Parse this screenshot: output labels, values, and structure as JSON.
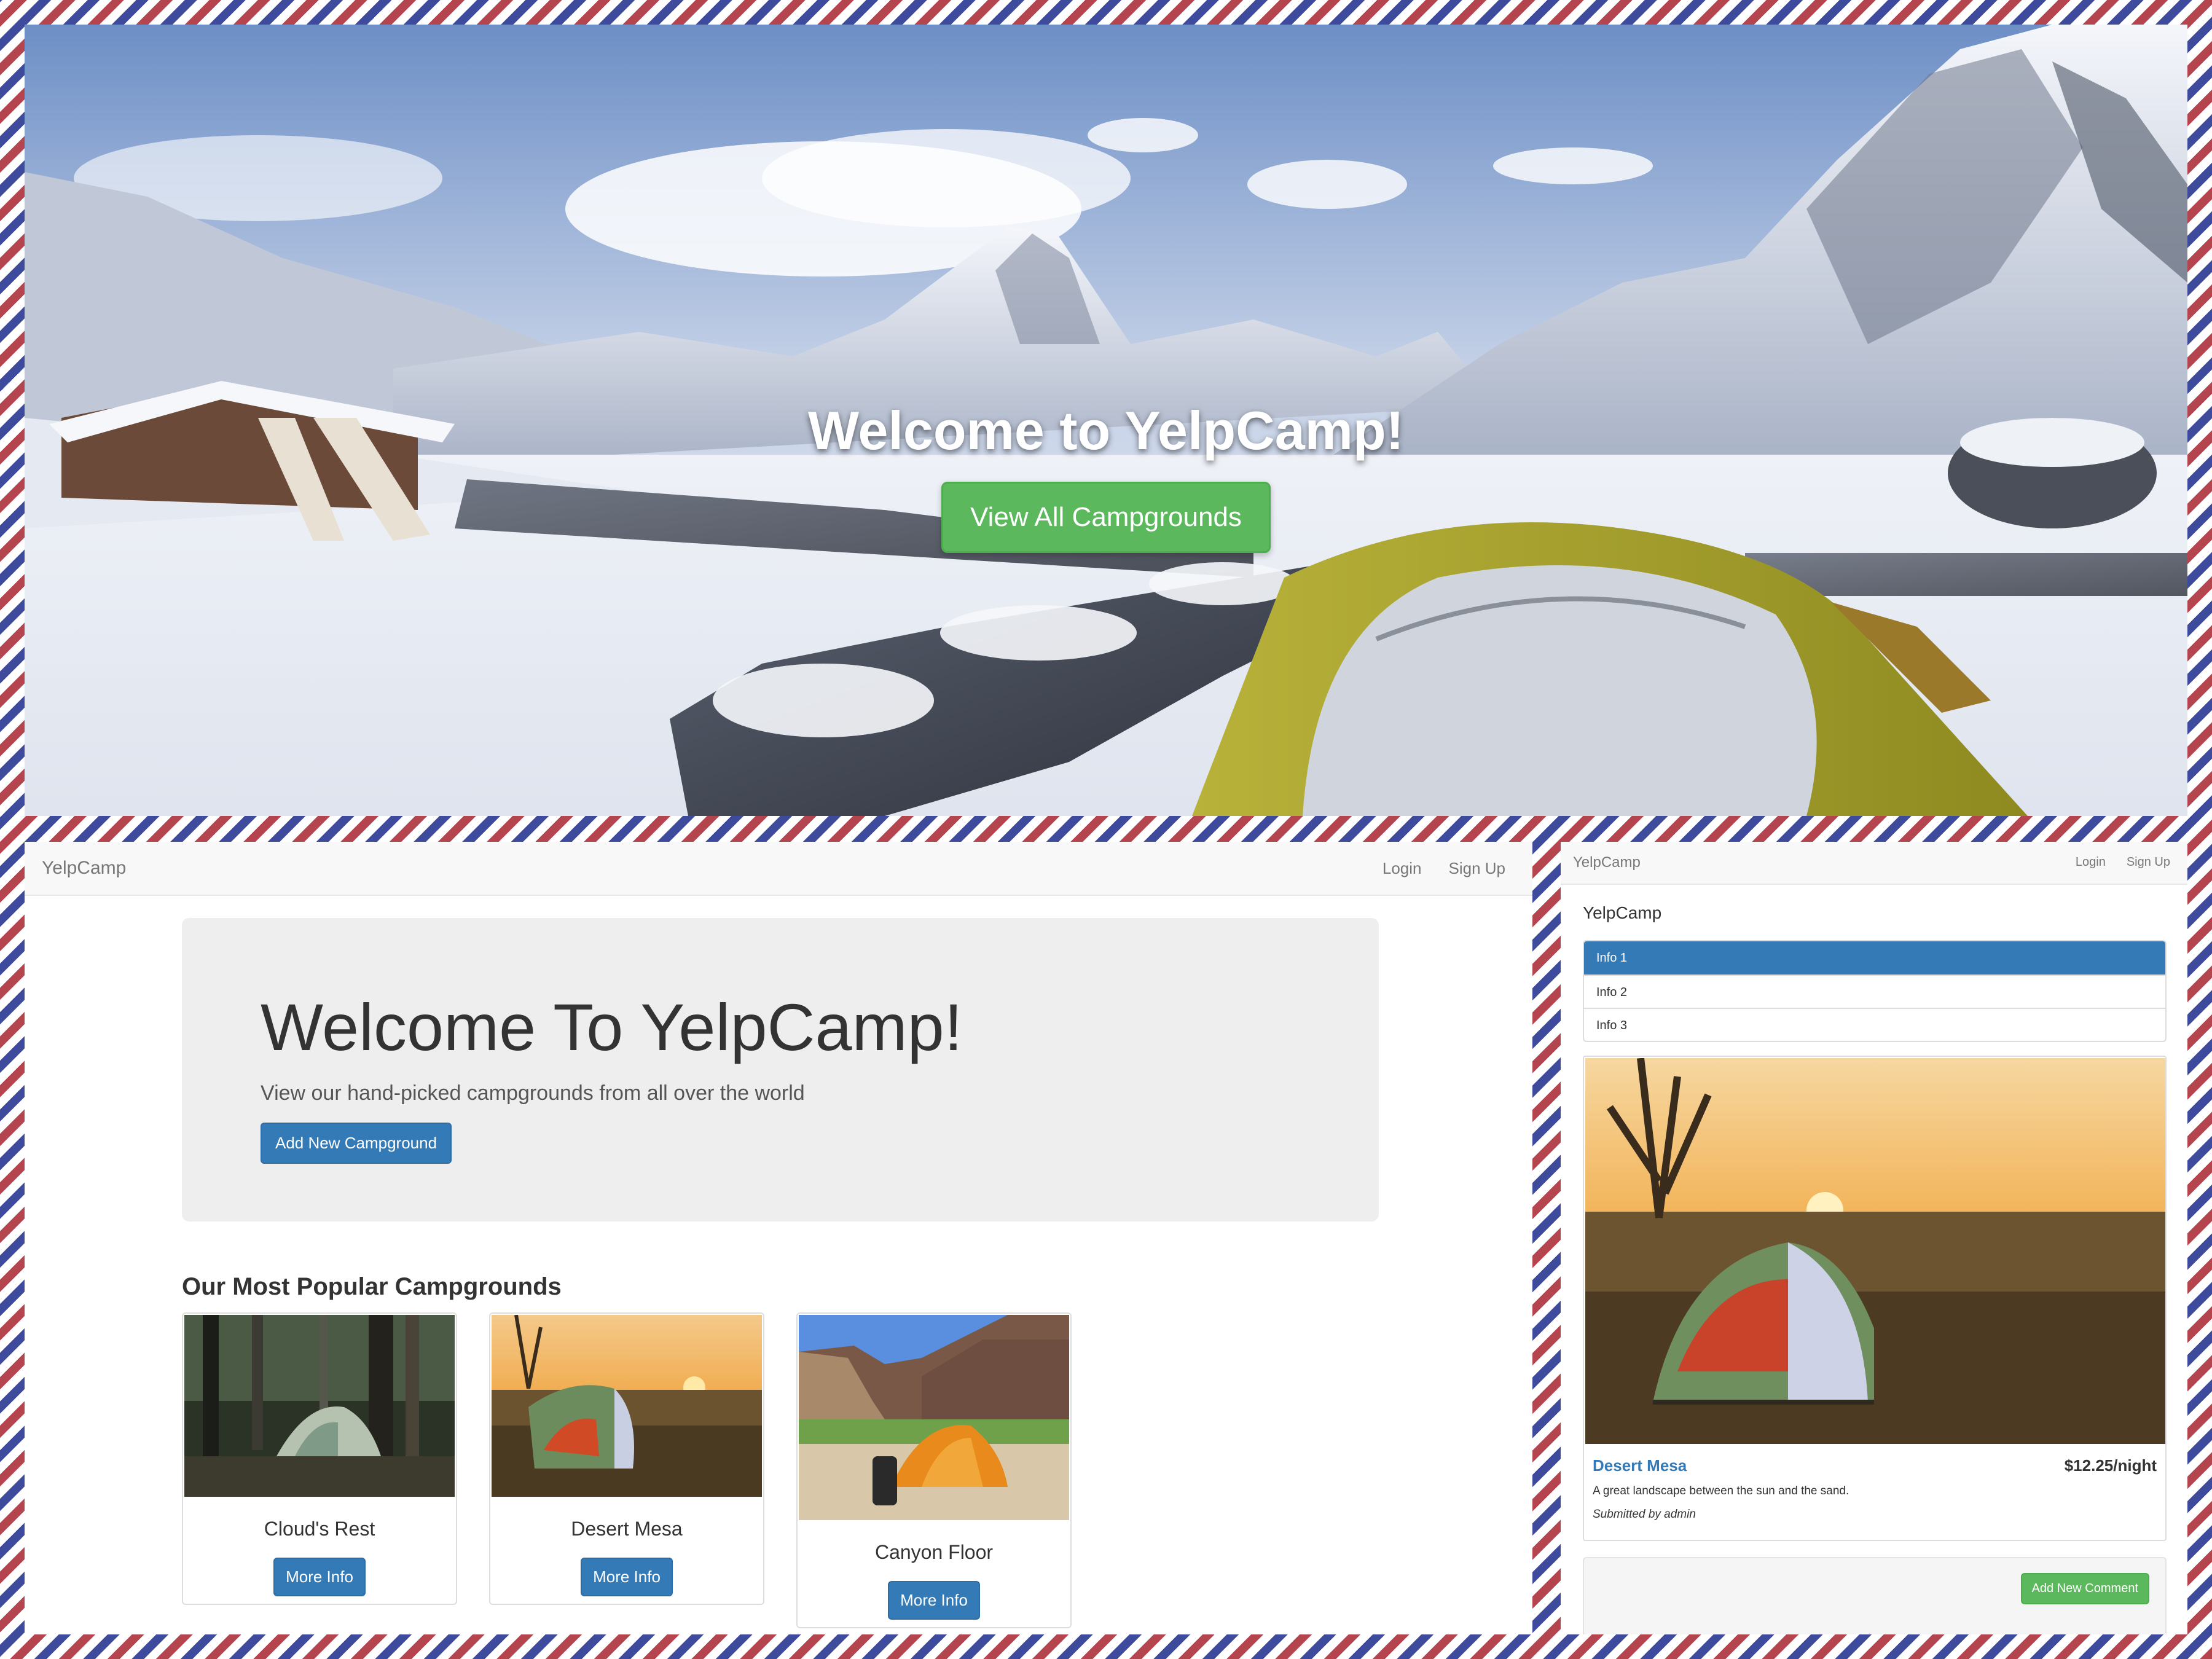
{
  "hero": {
    "title": "Welcome to YelpCamp!",
    "button_label": "View All Campgrounds"
  },
  "index_page": {
    "nav": {
      "brand": "YelpCamp",
      "login": "Login",
      "signup": "Sign Up"
    },
    "jumbotron": {
      "title": "Welcome To YelpCamp!",
      "subtitle": "View our hand-picked campgrounds from all over the world",
      "button_label": "Add New Campground"
    },
    "popular_heading": "Our Most Popular Campgrounds",
    "cards": [
      {
        "name": "Cloud's Rest",
        "button_label": "More Info"
      },
      {
        "name": "Desert Mesa",
        "button_label": "More Info"
      },
      {
        "name": "Canyon Floor",
        "button_label": "More Info"
      }
    ]
  },
  "show_page": {
    "nav": {
      "brand": "YelpCamp",
      "login": "Login",
      "signup": "Sign Up"
    },
    "sidebar": {
      "brand": "YelpCamp",
      "items": [
        {
          "label": "Info 1",
          "active": true
        },
        {
          "label": "Info 2",
          "active": false
        },
        {
          "label": "Info 3",
          "active": false
        }
      ]
    },
    "campground": {
      "name": "Desert Mesa",
      "price": "$12.25/night",
      "description": "A great landscape between the sun and the sand.",
      "submitted_by": "Submitted by admin"
    },
    "comments": {
      "button_label": "Add New Comment"
    }
  },
  "colors": {
    "primary": "#337ab7",
    "success": "#5cb85c",
    "airmail_red": "#b4454f",
    "airmail_blue": "#3e4a9c"
  }
}
